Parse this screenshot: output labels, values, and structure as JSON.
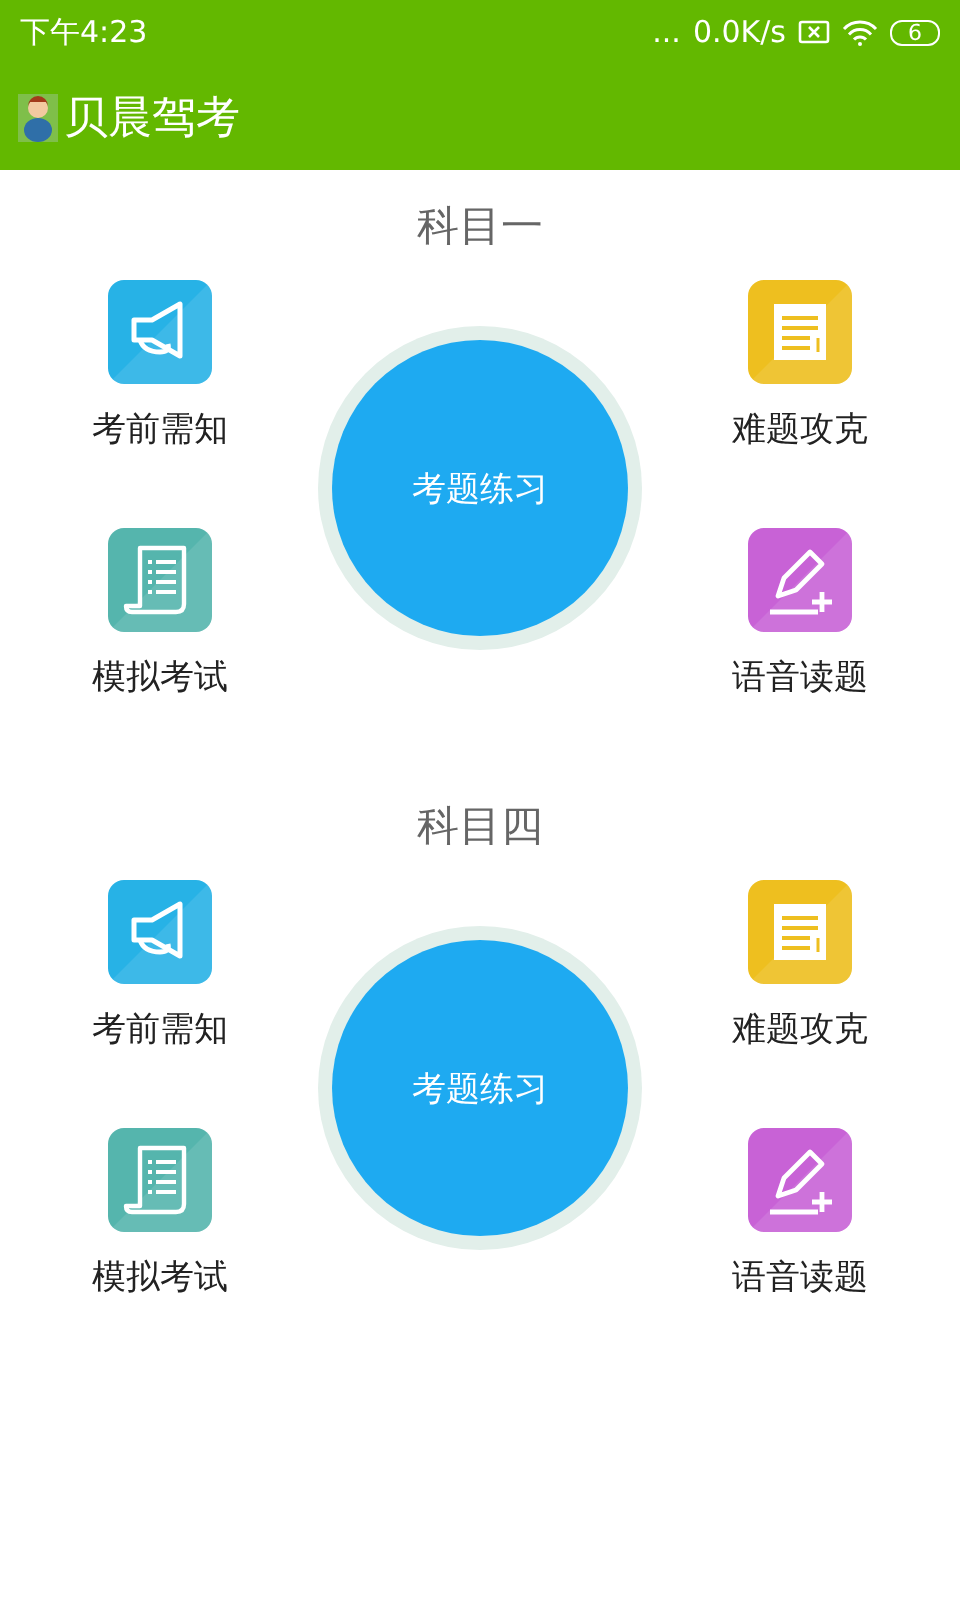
{
  "status_bar": {
    "time": "下午4:23",
    "more": "...",
    "speed": "0.0K/s",
    "battery": "6"
  },
  "app_bar": {
    "title": "贝晨驾考"
  },
  "sections": [
    {
      "title": "科目一",
      "center_button": "考题练习",
      "tiles": [
        {
          "label": "考前需知",
          "kind": "megaphone",
          "color": "#27b2e6"
        },
        {
          "label": "难题攻克",
          "kind": "notepad",
          "color": "#eebf1f"
        },
        {
          "label": "模拟考试",
          "kind": "scroll",
          "color": "#55b5ad"
        },
        {
          "label": "语音读题",
          "kind": "pen",
          "color": "#c862d6"
        }
      ]
    },
    {
      "title": "科目四",
      "center_button": "考题练习",
      "tiles": [
        {
          "label": "考前需知",
          "kind": "megaphone",
          "color": "#27b2e6"
        },
        {
          "label": "难题攻克",
          "kind": "notepad",
          "color": "#eebf1f"
        },
        {
          "label": "模拟考试",
          "kind": "scroll",
          "color": "#55b5ad"
        },
        {
          "label": "语音读题",
          "kind": "pen",
          "color": "#c862d6"
        }
      ]
    }
  ]
}
